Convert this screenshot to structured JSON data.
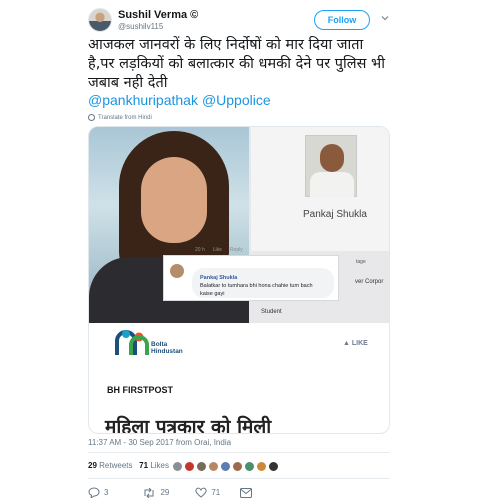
{
  "author": {
    "name": "Sushil Verma",
    "verified_glyph": "©",
    "handle": "@sushilv115"
  },
  "follow_label": "Follow",
  "tweet": {
    "text": "आजकल जानवरों के लिए निर्दोषों को मार दिया जाता है,पर लड़कियों को बलात्कार की धमकी देने पर पुलिस भी जबाब नही देती",
    "mentions": [
      "@pankhuripathak",
      "@Uppolice"
    ],
    "translate_label": "Translate from Hindi"
  },
  "media": {
    "video_name": "Pankaj Shukla",
    "comment_meta": [
      "20 h",
      "Like",
      "Reply"
    ],
    "comment_author": "Pankaj Shukla",
    "comment_text": "Balatkar to tumhara bhi hona chahie tum bach kaise gayi",
    "student_label": "Student",
    "stage_label": "tage",
    "corp_label": "ver Corpor",
    "logo_line1": "Bolta",
    "logo_line2": "Hindustan",
    "like_label": "LIKE",
    "source_label": "BH FIRSTPOST",
    "headline": "महिला पत्रकार को मिली"
  },
  "timestamp": "11:37 AM - 30 Sep 2017 from Orai, India",
  "stats": {
    "retweets_count": "29",
    "retweets_label": "Retweets",
    "likes_count": "71",
    "likes_label": "Likes"
  },
  "liker_colors": [
    "#8a8f96",
    "#c0392b",
    "#7a6a5c",
    "#b58a62",
    "#5b7db1",
    "#9c6b4f",
    "#4a8f6e",
    "#c98a3a",
    "#333333"
  ],
  "actions": {
    "reply_count": "3",
    "retweet_count": "29",
    "like_count": "71"
  },
  "colors": {
    "accent": "#1da1f2",
    "link": "#1b95e0",
    "muted": "#657786"
  }
}
